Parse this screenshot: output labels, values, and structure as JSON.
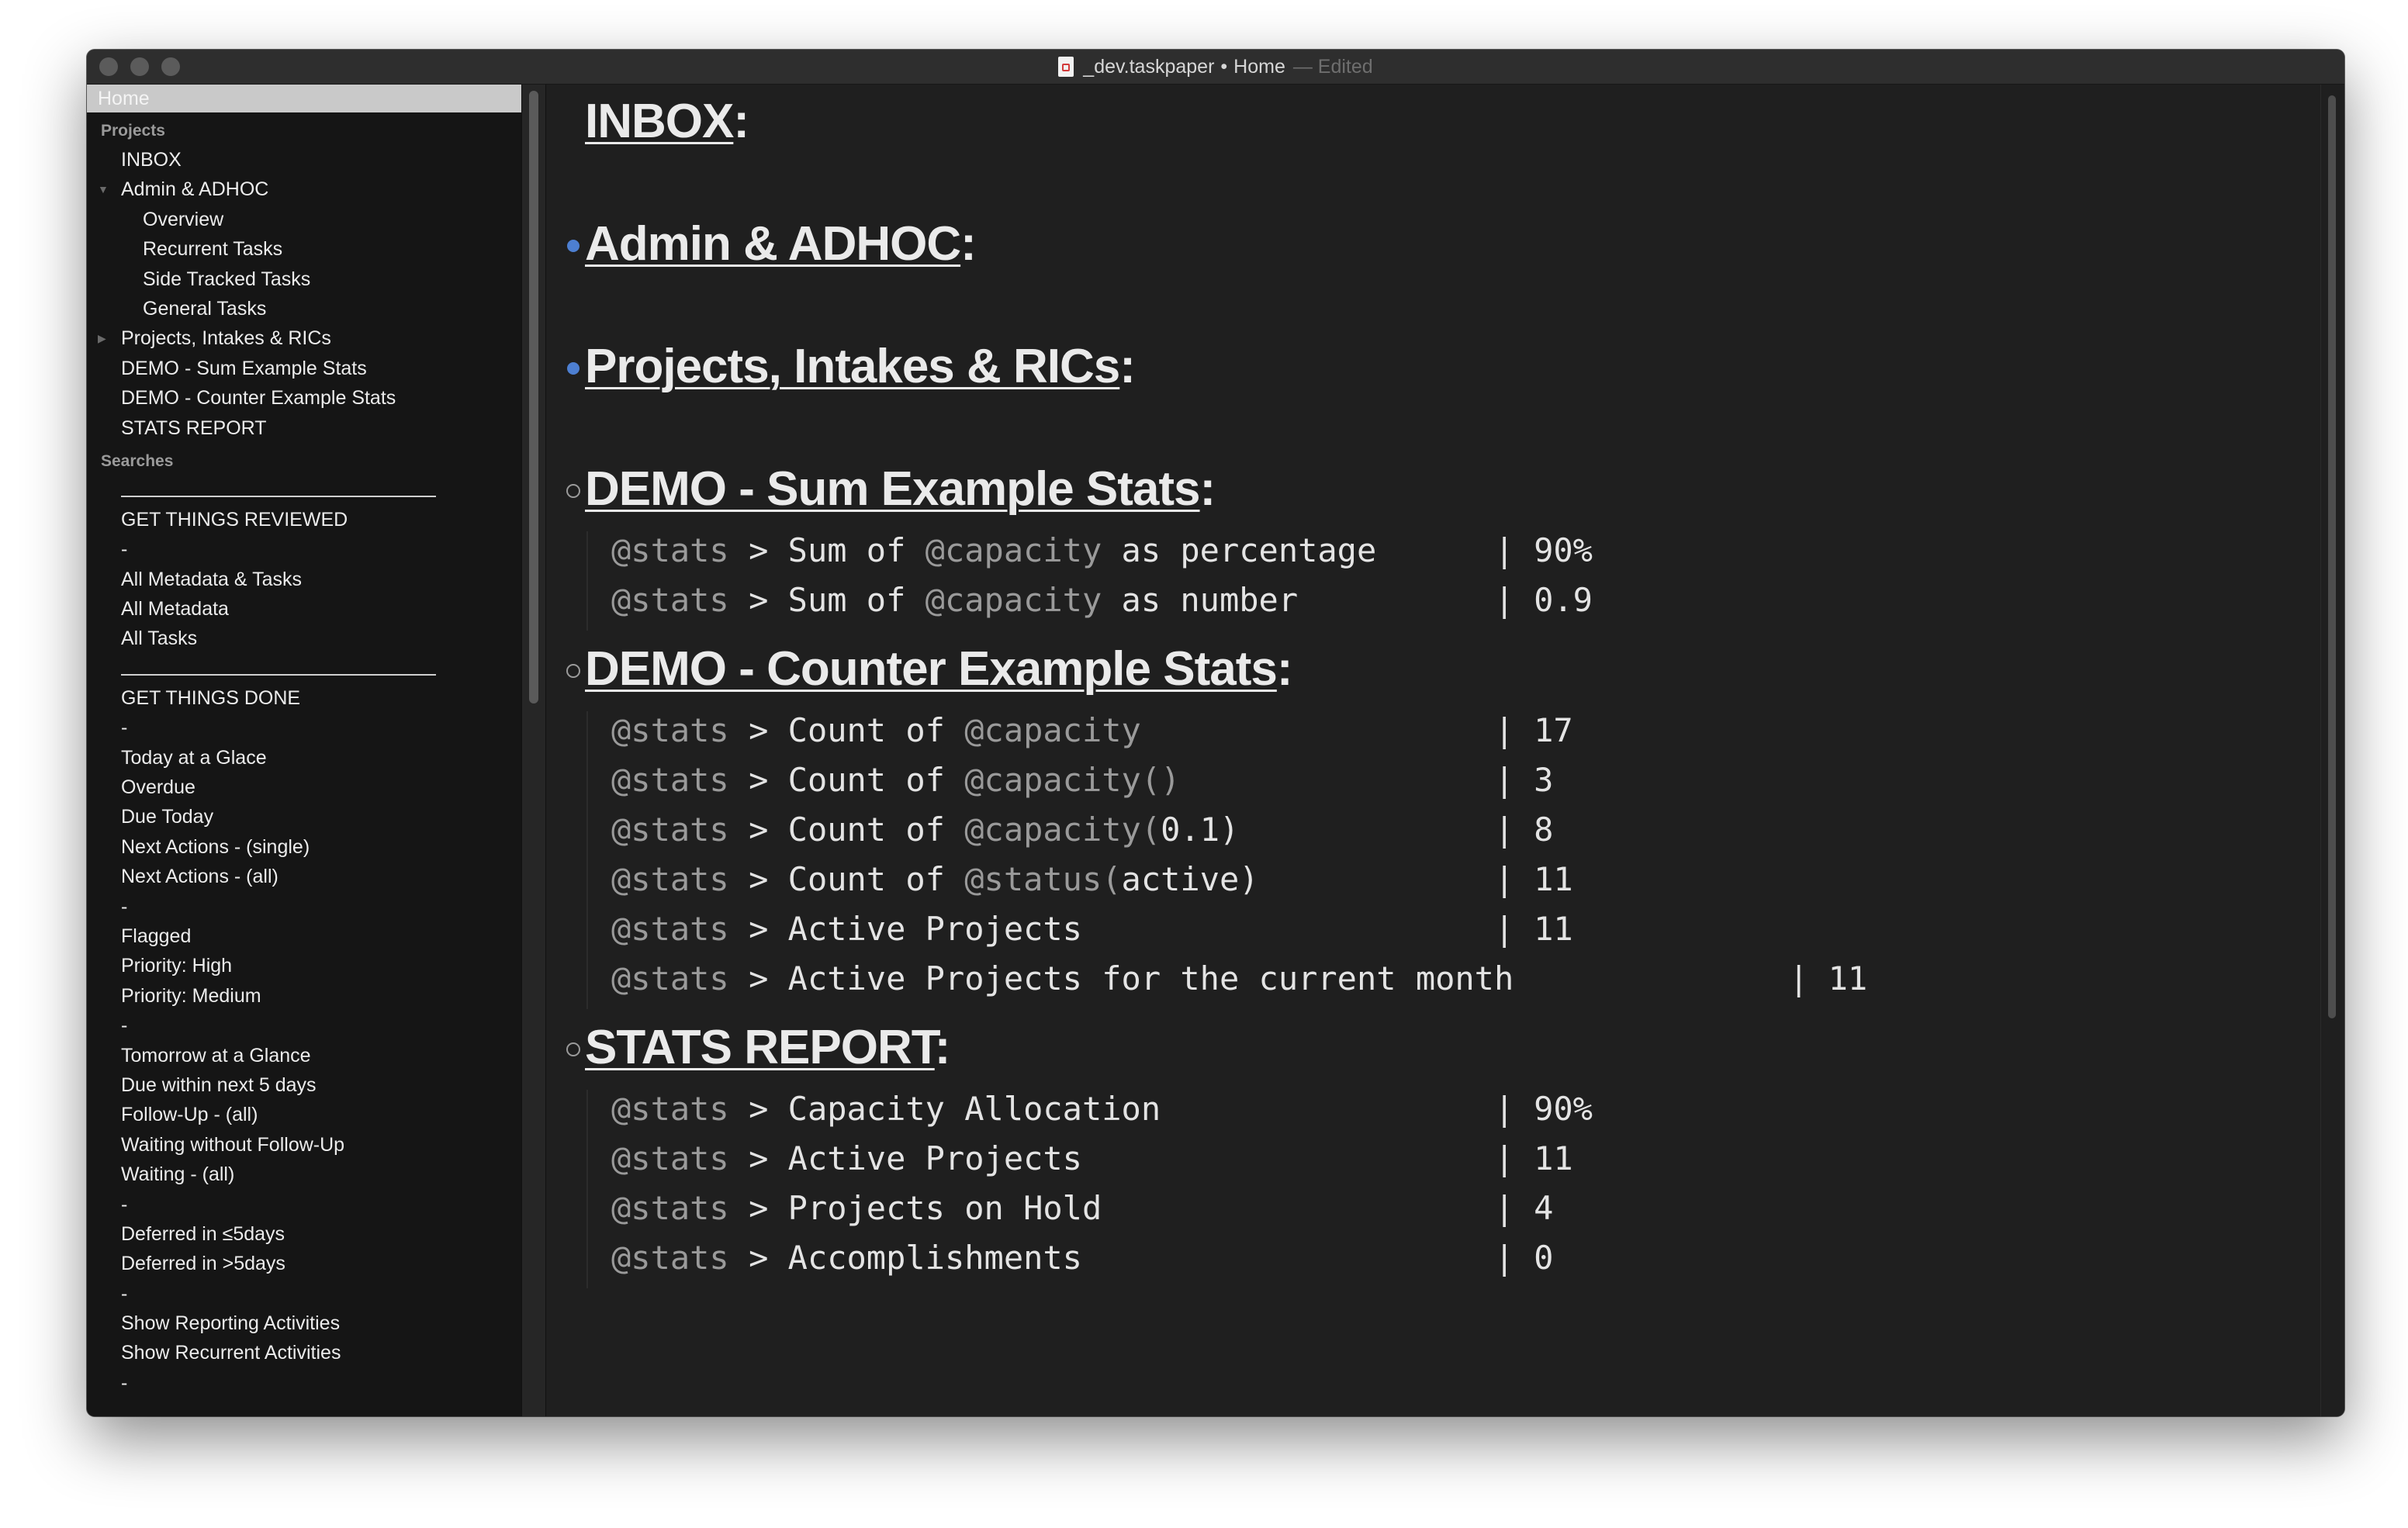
{
  "window": {
    "file": "_dev.taskpaper",
    "separator": "•",
    "location": "Home",
    "status": "— Edited"
  },
  "sidebar": {
    "home": "Home",
    "projects_heading": "Projects",
    "projects": [
      {
        "label": "INBOX"
      },
      {
        "label": "Admin & ADHOC",
        "expanded": true
      },
      {
        "label": "Overview"
      },
      {
        "label": "Recurrent Tasks"
      },
      {
        "label": "Side Tracked Tasks"
      },
      {
        "label": "General Tasks"
      },
      {
        "label": "Projects, Intakes & RICs",
        "collapsed": true
      },
      {
        "label": "DEMO - Sum Example Stats"
      },
      {
        "label": "DEMO - Counter Example Stats"
      },
      {
        "label": "STATS REPORT"
      }
    ],
    "searches_heading": "Searches",
    "searches": [
      {
        "label": "GET THINGS REVIEWED"
      },
      {
        "label": "-"
      },
      {
        "label": "All Metadata & Tasks"
      },
      {
        "label": "All Metadata"
      },
      {
        "label": "All Tasks"
      },
      {
        "label": "GET THINGS DONE"
      },
      {
        "label": "-"
      },
      {
        "label": "Today at a Glace"
      },
      {
        "label": "Overdue"
      },
      {
        "label": "Due Today"
      },
      {
        "label": "Next Actions - (single)"
      },
      {
        "label": "Next Actions - (all)"
      },
      {
        "label": "-"
      },
      {
        "label": "Flagged"
      },
      {
        "label": "Priority: High"
      },
      {
        "label": "Priority: Medium"
      },
      {
        "label": "-"
      },
      {
        "label": "Tomorrow at a Glance"
      },
      {
        "label": "Due within next 5 days"
      },
      {
        "label": "Follow-Up - (all)"
      },
      {
        "label": "Waiting without Follow-Up"
      },
      {
        "label": "Waiting - (all)"
      },
      {
        "label": "-"
      },
      {
        "label": "Deferred in ≤5days"
      },
      {
        "label": "Deferred in >5days"
      },
      {
        "label": "-"
      },
      {
        "label": "Show Reporting Activities"
      },
      {
        "label": "Show Recurrent Activities"
      },
      {
        "label": "-"
      }
    ]
  },
  "editor": {
    "colon": ":",
    "tag_stats": "@stats",
    "pipe": "|",
    "projects": [
      {
        "name": "INBOX",
        "bullet": "none"
      },
      {
        "name": "Admin & ADHOC",
        "bullet": "filled"
      },
      {
        "name": "Projects, Intakes & RICs",
        "bullet": "filled"
      },
      {
        "name": "DEMO - Sum Example Stats",
        "bullet": "open",
        "lines": [
          {
            "pre": "> Sum of ",
            "tag": "@capacity",
            "post": " as percentage",
            "value": "90%"
          },
          {
            "pre": "> Sum of ",
            "tag": "@capacity",
            "post": " as number",
            "value": "0.9"
          }
        ]
      },
      {
        "name": "DEMO - Counter Example Stats",
        "bullet": "open",
        "lines": [
          {
            "pre": "> Count of ",
            "tag": "@capacity",
            "post": "",
            "value": "17"
          },
          {
            "pre": "> Count of ",
            "tag": "@capacity()",
            "post": "",
            "value": "3"
          },
          {
            "pre": "> Count of ",
            "tag": "@capacity(",
            "post": "0.1)",
            "value": "8"
          },
          {
            "pre": "> Count of ",
            "tag": "@status(",
            "post": "active)",
            "value": "11"
          },
          {
            "pre": "> Active Projects",
            "tag": "",
            "post": "",
            "value": "11"
          },
          {
            "pre": "> Active Projects for the current month",
            "tag": "",
            "post": "",
            "value": "11",
            "wide": true
          }
        ]
      },
      {
        "name": "STATS REPORT",
        "bullet": "open",
        "lines": [
          {
            "pre": "> Capacity Allocation",
            "tag": "",
            "post": "",
            "value": "90%"
          },
          {
            "pre": "> Active Projects",
            "tag": "",
            "post": "",
            "value": "11"
          },
          {
            "pre": "> Projects on Hold",
            "tag": "",
            "post": "",
            "value": "4"
          },
          {
            "pre": "> Accomplishments",
            "tag": "",
            "post": "",
            "value": "0"
          }
        ]
      }
    ]
  }
}
